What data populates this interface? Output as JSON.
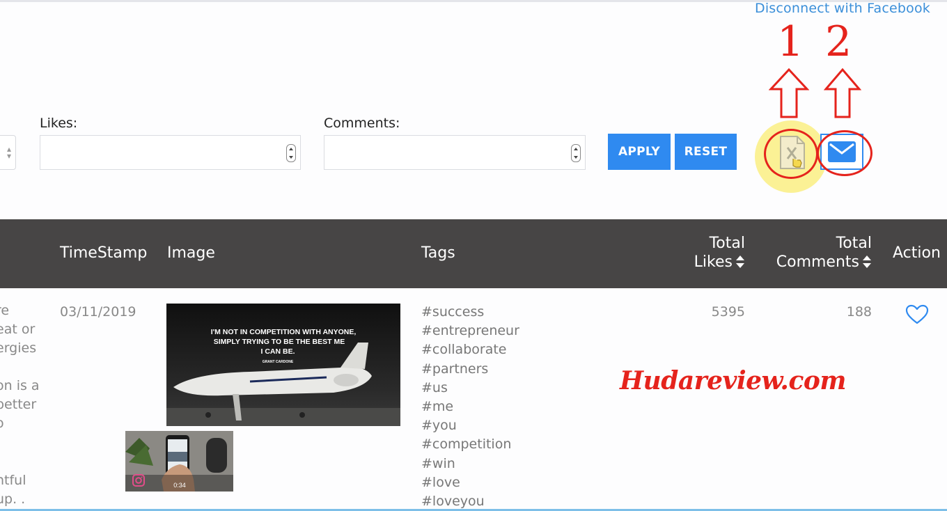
{
  "header": {
    "disconnect_link": "Disconnect with Facebook"
  },
  "annotations": {
    "label_1": "1",
    "label_2": "2",
    "accent_color": "#e5231c"
  },
  "filters": {
    "likes_label": "Likes:",
    "comments_label": "Comments:",
    "likes_value": "",
    "comments_value": "",
    "apply_label": "APPLY",
    "reset_label": "RESET"
  },
  "export": {
    "excel_icon": "excel-file-icon",
    "email_icon": "envelope-icon"
  },
  "table": {
    "columns": {
      "timestamp": "TimeStamp",
      "image": "Image",
      "tags": "Tags",
      "total_likes_1": "Total",
      "total_likes_2": "Likes",
      "total_comments_1": "Total",
      "total_comments_2": "Comments",
      "action": "Action"
    },
    "row": {
      "desc_lines": [
        "re",
        "eat or",
        "ergies",
        "",
        "on is a",
        "better",
        "o",
        "",
        "",
        "ntful",
        "up. ."
      ],
      "timestamp": "03/11/2019",
      "image_quote_1": "I'M NOT IN COMPETITION WITH ANYONE,",
      "image_quote_2": "SIMPLY TRYING TO BE THE BEST ME",
      "image_quote_3": "I CAN BE.",
      "image_quote_author": "GRANT CARDONE",
      "tags": [
        "#success",
        "#entrepreneur",
        "#collaborate",
        "#partners",
        "#us",
        "#me",
        "#you",
        "#competition",
        "#win",
        "#love",
        "#loveyou"
      ],
      "total_likes": "5395",
      "total_comments": "188",
      "action_icon": "heart-icon"
    }
  },
  "video": {
    "duration": "0:34",
    "icon": "instagram-icon"
  },
  "watermark": "Hudareview.com",
  "colors": {
    "primary": "#2f8af0",
    "header_bg": "#474545",
    "link": "#3b8fd9"
  }
}
